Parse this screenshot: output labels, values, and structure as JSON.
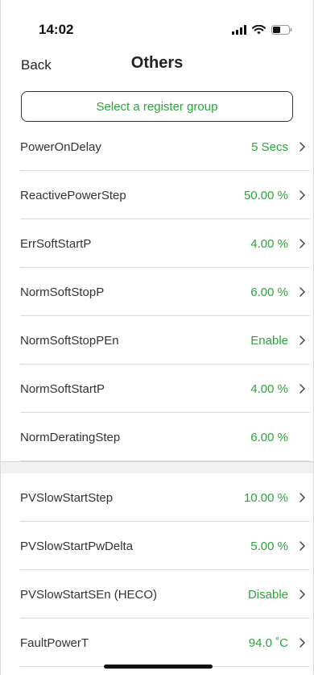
{
  "status_bar": {
    "time": "14:02",
    "icons": [
      "signal-icon",
      "wifi-icon",
      "battery-icon"
    ]
  },
  "nav": {
    "back_label": "Back",
    "title": "Others"
  },
  "select_group": {
    "label": "Select a register group"
  },
  "group1": [
    {
      "label": "PowerOnDelay",
      "value": "5 Secs",
      "chevron": true
    },
    {
      "label": "ReactivePowerStep",
      "value": "50.00 %",
      "chevron": true
    },
    {
      "label": "ErrSoftStartP",
      "value": "4.00 %",
      "chevron": true
    },
    {
      "label": "NormSoftStopP",
      "value": "6.00 %",
      "chevron": true
    },
    {
      "label": "NormSoftStopPEn",
      "value": "Enable",
      "chevron": true
    },
    {
      "label": "NormSoftStartP",
      "value": "4.00 %",
      "chevron": true
    },
    {
      "label": "NormDeratingStep",
      "value": "6.00 %",
      "chevron": false
    }
  ],
  "group2": [
    {
      "label": "PVSlowStartStep",
      "value": "10.00 %",
      "chevron": true
    },
    {
      "label": "PVSlowStartPwDelta",
      "value": "5.00 %",
      "chevron": true
    },
    {
      "label": "PVSlowStartSEn (HECO)",
      "value": "Disable",
      "chevron": true
    },
    {
      "label": "FaultPowerT",
      "value": "94.0 ˚C",
      "chevron": true
    }
  ],
  "colors": {
    "accent": "#2aa43a",
    "text": "#333333",
    "divider": "#d9d9d9",
    "section_gap": "#f1f1f1"
  }
}
